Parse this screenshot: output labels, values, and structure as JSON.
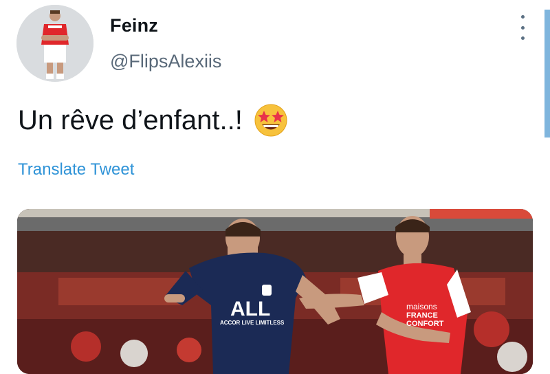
{
  "tweet": {
    "display_name": "Feinz",
    "handle": "@FlipsAlexiis",
    "text": "Un rêve d’enfant..!",
    "emoji": "star-struck-emoji",
    "translate_label": "Translate Tweet",
    "avatar_icon": "player-avatar-icon",
    "more_icon": "more-vertical-icon"
  },
  "media": {
    "left_player": {
      "shirt_brand": "ALL",
      "shirt_sub": "ACCOR LIVE LIMITLESS",
      "kit_color": "#1b2a55"
    },
    "right_player": {
      "shirt_line1": "maisons",
      "shirt_line2": "FRANCE",
      "shirt_line3": "CONFORT",
      "kit_color": "#e0272b"
    }
  },
  "colors": {
    "link": "#2f93d7",
    "text": "#0f1419",
    "secondary": "#586878",
    "accent_bar": "#7fb5dd"
  }
}
